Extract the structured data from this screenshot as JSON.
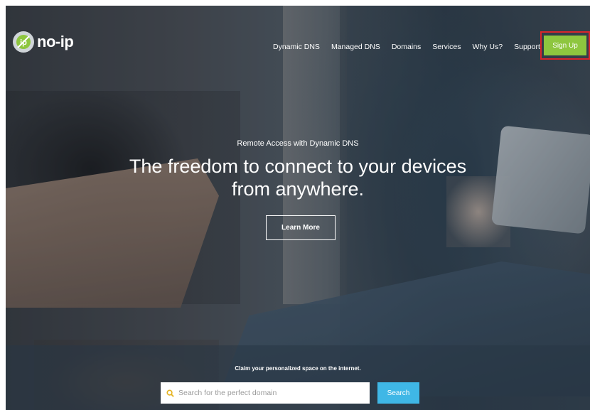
{
  "brand": {
    "logo_text": "no-ip",
    "logo_icon": "no-ip-logo-icon"
  },
  "nav": {
    "items": [
      {
        "label": "Dynamic DNS"
      },
      {
        "label": "Managed DNS"
      },
      {
        "label": "Domains"
      },
      {
        "label": "Services"
      },
      {
        "label": "Why Us?"
      },
      {
        "label": "Support"
      }
    ],
    "signup_label": "Sign Up"
  },
  "hero": {
    "subheading": "Remote Access with Dynamic DNS",
    "headline_line1": "The freedom to connect to your devices",
    "headline_line2": "from anywhere.",
    "cta_label": "Learn More"
  },
  "domain_search": {
    "tagline": "Claim your personalized space on the internet.",
    "placeholder": "Search for the perfect domain",
    "button_label": "Search",
    "icon": "search-icon"
  },
  "colors": {
    "signup_bg": "#8ec63f",
    "signup_highlight_border": "#d9262c",
    "search_button_bg": "#3fb7e6",
    "search_icon": "#e6b422"
  }
}
